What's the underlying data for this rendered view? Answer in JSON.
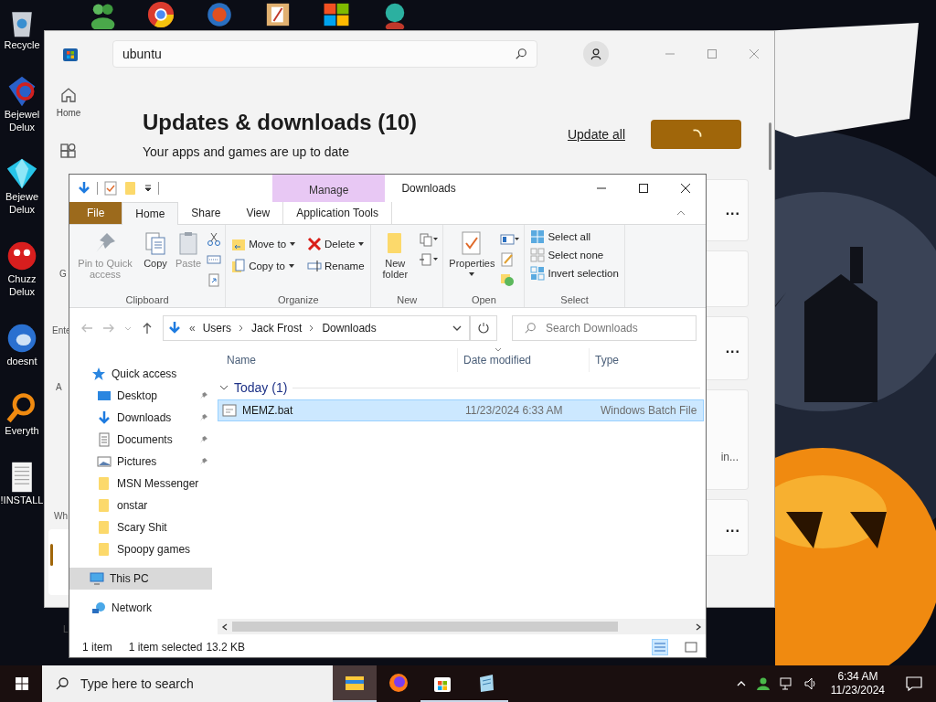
{
  "desktop": {
    "top_icons": [
      {
        "kind": "people"
      },
      {
        "kind": "browser"
      },
      {
        "kind": "swirl"
      },
      {
        "kind": "paint"
      },
      {
        "kind": "tiles"
      },
      {
        "kind": "figure"
      }
    ],
    "icons": [
      {
        "kind": "bin",
        "lines": [
          "Recycle"
        ]
      },
      {
        "kind": "gem2",
        "lines": [
          "Bejewel",
          "Delux"
        ]
      },
      {
        "kind": "gem",
        "lines": [
          "Bejewe",
          "Delux"
        ]
      },
      {
        "kind": "ball",
        "lines": [
          "Chuzz",
          "Delux"
        ]
      },
      {
        "kind": "bird",
        "lines": [
          "doesnt"
        ]
      },
      {
        "kind": "search",
        "lines": [
          "Everyth"
        ]
      },
      {
        "kind": "doc",
        "lines": [
          "!INSTALL"
        ]
      }
    ]
  },
  "store": {
    "search": {
      "value": "ubuntu"
    },
    "nav": [
      {
        "kind": "home",
        "label": "Home"
      },
      {
        "kind": "apps"
      }
    ],
    "nav_fragments": [
      "G",
      "Ente",
      "A",
      "Wh",
      "L"
    ],
    "heading": "Updates & downloads (10)",
    "subheading": "Your apps and games are up to date",
    "update_all": "Update all",
    "update_busy": true,
    "items": [
      {
        "more": "..."
      },
      {
        "kind": "card"
      },
      {
        "more": "..."
      },
      {
        "text": "in..."
      },
      {
        "more": "..."
      }
    ]
  },
  "explorer": {
    "title": "Downloads",
    "context_tab": "Manage",
    "tabs": [
      {
        "label": "File",
        "kind": "file",
        "selected": false
      },
      {
        "label": "Home",
        "kind": "tab",
        "selected": true
      },
      {
        "label": "Share",
        "kind": "tab",
        "selected": false
      },
      {
        "label": "View",
        "kind": "tab",
        "selected": false
      },
      {
        "label": "Application Tools",
        "kind": "context",
        "selected": false
      }
    ],
    "ribbon": {
      "clipboard": {
        "label": "Clipboard",
        "pin": {
          "label": "Pin to Quick access",
          "disabled": true
        },
        "copy": {
          "label": "Copy",
          "disabled": false
        },
        "paste": {
          "label": "Paste",
          "disabled": true
        }
      },
      "organize": {
        "label": "Organize",
        "move_to": "Move to",
        "copy_to": "Copy to",
        "delete": "Delete",
        "rename": "Rename"
      },
      "new": {
        "label": "New",
        "new_folder": "New folder"
      },
      "open": {
        "label": "Open",
        "properties": "Properties"
      },
      "select": {
        "label": "Select",
        "items": [
          "Select all",
          "Select none",
          "Invert selection"
        ]
      }
    },
    "address": {
      "overflow": "«",
      "path": [
        "Users",
        "Jack Frost",
        "Downloads"
      ],
      "search_placeholder": "Search Downloads"
    },
    "nav": [
      {
        "label": "Quick access",
        "kind": "star",
        "selected": false,
        "children": [
          {
            "label": "Desktop",
            "kind": "desktop",
            "pinned": true,
            "selected": false
          },
          {
            "label": "Downloads",
            "kind": "download",
            "pinned": true,
            "selected": false
          },
          {
            "label": "Documents",
            "kind": "documents",
            "pinned": true,
            "selected": false
          },
          {
            "label": "Pictures",
            "kind": "pictures",
            "pinned": true,
            "selected": false
          },
          {
            "label": "MSN Messenger",
            "kind": "folder",
            "pinned": false,
            "selected": false
          },
          {
            "label": "onstar",
            "kind": "folder",
            "pinned": false,
            "selected": false
          },
          {
            "label": "Scary Shit",
            "kind": "folder",
            "pinned": false,
            "selected": false
          },
          {
            "label": "Spoopy games",
            "kind": "folder",
            "pinned": false,
            "selected": false
          }
        ]
      },
      {
        "label": "This PC",
        "kind": "pc",
        "selected": true
      },
      {
        "label": "Network",
        "kind": "network",
        "selected": false
      }
    ],
    "columns": [
      {
        "label": "Name",
        "sorted": false
      },
      {
        "label": "Date modified",
        "sorted": true
      },
      {
        "label": "Type",
        "sorted": false
      }
    ],
    "groups": [
      {
        "label": "Today (1)",
        "expanded": true,
        "rows": [
          {
            "name": "MEMZ.bat",
            "date": "11/23/2024 6:33 AM",
            "type": "Windows Batch File",
            "selected": true
          }
        ]
      }
    ],
    "status": {
      "count": "1 item",
      "selected": "1 item selected",
      "size": "13.2 KB"
    }
  },
  "taskbar": {
    "search_placeholder": "Type here to search",
    "apps": [
      {
        "kind": "folder",
        "active": true,
        "running": true
      },
      {
        "kind": "firefox",
        "active": false,
        "running": false
      },
      {
        "kind": "store",
        "active": false,
        "running": true
      },
      {
        "kind": "notepad",
        "active": false,
        "running": true
      }
    ],
    "time": "6:34 AM",
    "date": "11/23/2024"
  }
}
